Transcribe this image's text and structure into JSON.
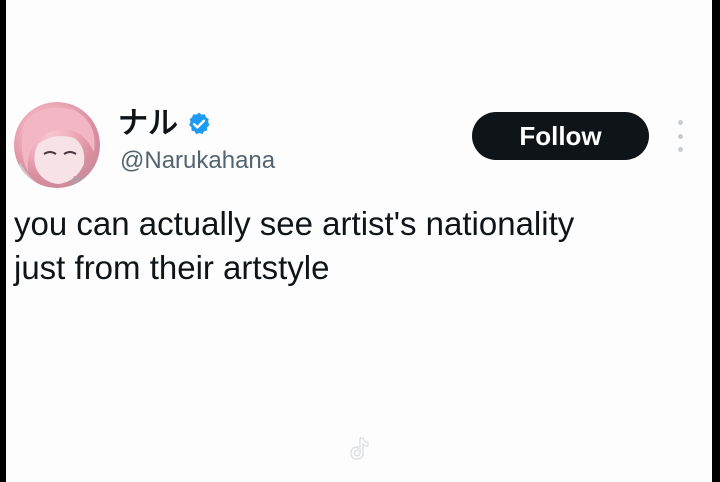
{
  "post": {
    "display_name": "ナル",
    "handle": "@Narukahana",
    "verified": true,
    "text": "you can actually see artist's nationality\njust from their artstyle",
    "follow_label": "Follow"
  },
  "icons": {
    "verified": "verified-badge-icon",
    "more": "more-vertical-icon",
    "watermark": "tiktok-logo-icon"
  },
  "colors": {
    "follow_bg": "#0f1419",
    "verified": "#1d9bf0",
    "text": "#0f1419",
    "handle": "#536471"
  }
}
